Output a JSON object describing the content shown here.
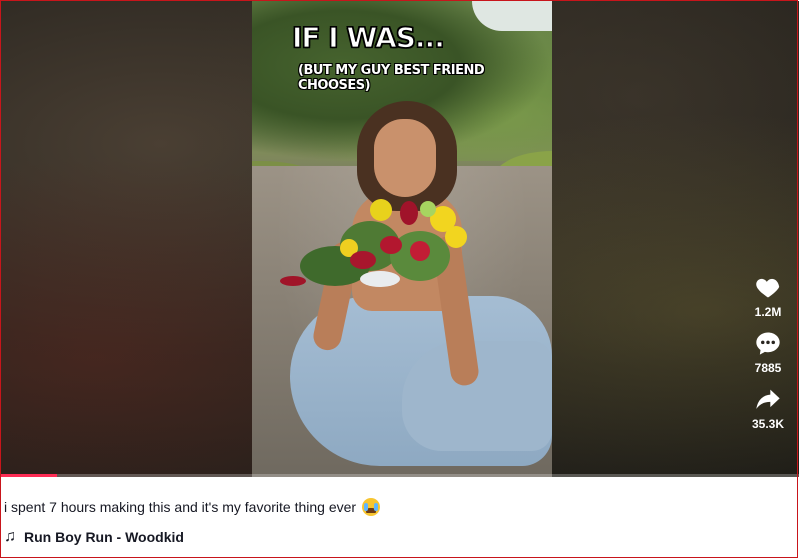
{
  "video": {
    "overlay_title": "IF I WAS...",
    "overlay_subtitle": "(BUT MY GUY BEST FRIEND CHOOSES)",
    "progress_fraction": 0.07
  },
  "actions": {
    "like": {
      "icon": "heart-icon",
      "count": "1.2M"
    },
    "comment": {
      "icon": "comment-icon",
      "count": "7885"
    },
    "share": {
      "icon": "share-icon",
      "count": "35.3K"
    }
  },
  "caption": {
    "text": "i spent 7 hours making this and it's my favorite thing ever",
    "emoji": "loudly-crying-face-emoji"
  },
  "music": {
    "icon": "music-note-icon",
    "glyph": "♫",
    "title": "Run Boy Run - Woodkid"
  },
  "colors": {
    "accent": "#fe2c55",
    "text": "#161823",
    "border": "#c8151b"
  }
}
